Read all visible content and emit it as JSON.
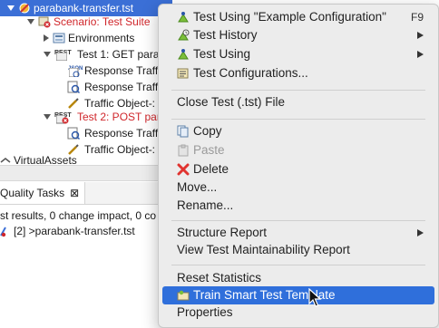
{
  "tree": {
    "rows": [
      {
        "label": "parabank-transfer.tst",
        "selected": true
      },
      {
        "label": "Scenario: Test Suite"
      },
      {
        "label": "Environments"
      },
      {
        "label": "Test 1: GET parab"
      },
      {
        "label": "Response Traff"
      },
      {
        "label": "Response Traff"
      },
      {
        "label": "Traffic Object-:"
      },
      {
        "label": "Test 2: POST para"
      },
      {
        "label": "Response Traff"
      },
      {
        "label": "Traffic Object-:"
      },
      {
        "label": "VirtualAssets"
      }
    ],
    "icon_labels": {
      "rest": "REST",
      "json": "JSON"
    }
  },
  "quality_tasks": {
    "tab_label": "Quality Tasks",
    "close_glyph": "⊠",
    "summary": "st results, 0 change impact, 0 co",
    "item_label": "[2] >parabank-transfer.tst"
  },
  "menu": {
    "items": [
      {
        "label": "Test Using \"Example Configuration\"",
        "shortcut": "F9",
        "icon": "test-run-icon"
      },
      {
        "label": "Test History",
        "icon": "test-history-icon",
        "submenu": true
      },
      {
        "label": "Test Using",
        "icon": "test-using-icon",
        "submenu": true
      },
      {
        "label": "Test Configurations...",
        "icon": "test-configurations-icon"
      },
      {
        "label": "Close Test (.tst) File"
      },
      {
        "label": "Copy",
        "icon": "copy-icon"
      },
      {
        "label": "Paste",
        "icon": "paste-icon",
        "disabled": true
      },
      {
        "label": "Delete",
        "icon": "delete-icon"
      },
      {
        "label": "Move..."
      },
      {
        "label": "Rename..."
      },
      {
        "label": "Structure Report",
        "submenu": true
      },
      {
        "label": "View Test Maintainability Report"
      },
      {
        "label": "Reset Statistics"
      },
      {
        "label": "Train Smart Test Template",
        "icon": "train-template-icon",
        "highlighted": true
      },
      {
        "label": "Properties"
      }
    ]
  },
  "colors": {
    "selection": "#3b6fd6",
    "highlight": "#2f6fdb",
    "error_red": "#d0262b",
    "delete_red": "#e0332f"
  }
}
